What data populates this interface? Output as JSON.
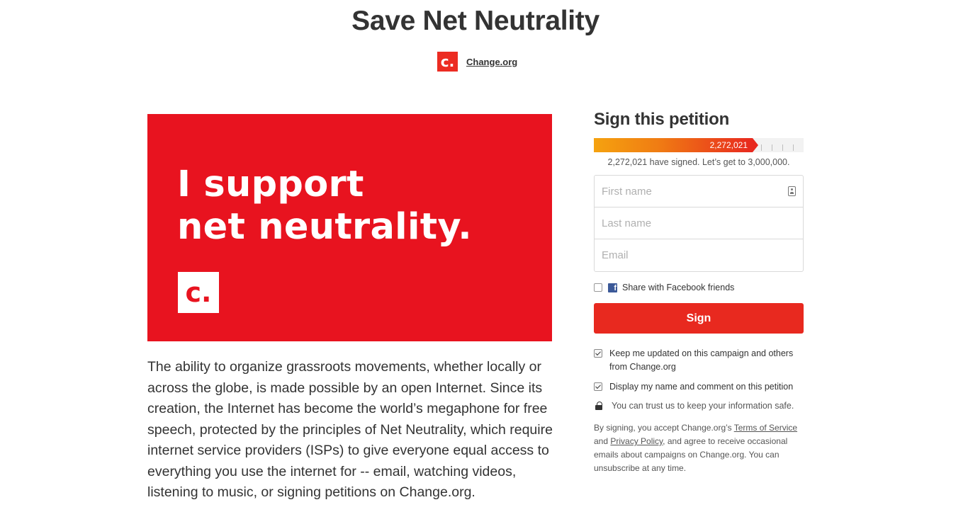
{
  "page": {
    "title": "Save Net Neutrality",
    "org_logo_letter": "c.",
    "org_name": "Change.org"
  },
  "hero": {
    "line1": "I support",
    "line2": "net neutrality.",
    "logo_letter": "c.",
    "background_color": "#e8131f"
  },
  "description": "The ability to organize grassroots movements, whether locally or across the globe, is made possible by an open Internet. Since its creation, the Internet has become the world’s megaphone for free speech, protected by the principles of Net Neutrality, which require internet service providers (ISPs) to give everyone equal access to everything you use the internet for -- email, watching videos, listening to music, or signing petitions on Change.org.",
  "petition": {
    "heading": "Sign this petition",
    "progress_label": "2,272,021",
    "progress_fraction": 0.757,
    "signed_text": "2,272,021 have signed. Let’s get to 3,000,000.",
    "fields": {
      "first_name_placeholder": "First name",
      "last_name_placeholder": "Last name",
      "email_placeholder": "Email"
    },
    "share_facebook_label": "Share with Facebook friends",
    "sign_button": "Sign",
    "keep_updated_label": "Keep me updated on this campaign and others from Change.org",
    "display_name_label": "Display my name and comment on this petition",
    "trust_text": "You can trust us to keep your information safe.",
    "legal": {
      "prefix": "By signing, you accept Change.org’s",
      "terms_link": "Terms of Service",
      "and": "and",
      "privacy_link": "Privacy Policy",
      "suffix": ", and agree to receive occasional emails about campaigns on Change.org. You can unsubscribe at any time."
    },
    "accent_color": "#e8291f"
  }
}
